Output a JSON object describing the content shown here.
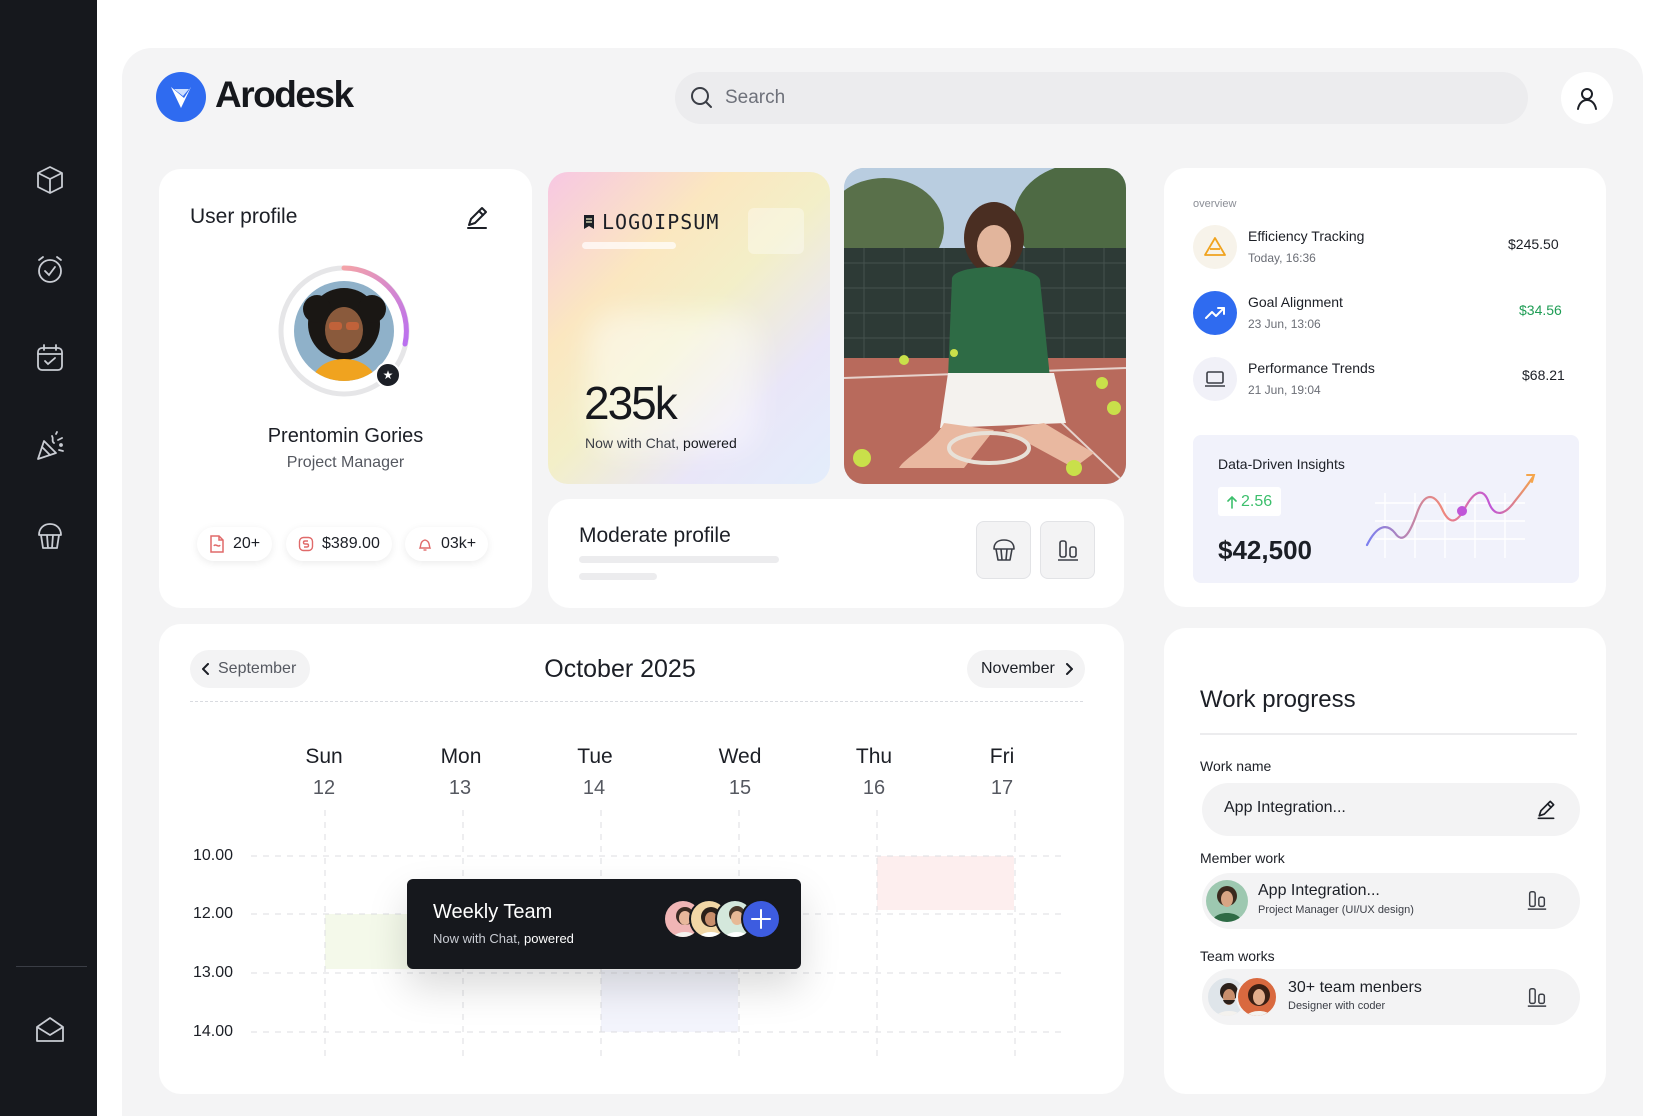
{
  "app": {
    "name": "Arodesk"
  },
  "search": {
    "placeholder": "Search"
  },
  "icons": {
    "sidebar": [
      "box-icon",
      "alarm-clock-icon",
      "calendar-check-icon",
      "party-popper-icon",
      "cupcake-icon",
      "mail-icon"
    ]
  },
  "user_profile": {
    "title": "User profile",
    "name": "Prentomin Gories",
    "role": "Project Manager",
    "stats": [
      {
        "icon": "file-icon",
        "value": "20+"
      },
      {
        "icon": "dollar-badge-icon",
        "value": "$389.00"
      },
      {
        "icon": "bell-icon",
        "value": "03k+"
      }
    ]
  },
  "promo": {
    "logo_text": "LOGOIPSUM",
    "metric": "235k",
    "caption_prefix": "Now with Chat,",
    "caption_bold": "powered"
  },
  "moderate_profile": {
    "title": "Moderate profile"
  },
  "overview": {
    "label": "overview",
    "items": [
      {
        "title": "Efficiency Tracking",
        "date": "Today, 16:36",
        "amount": "$245.50",
        "amount_color": "#1c1f26"
      },
      {
        "title": "Goal Alignment",
        "date": "23 Jun, 13:06",
        "amount": "$34.56",
        "amount_color": "#1f9d55"
      },
      {
        "title": "Performance Trends",
        "date": "21 Jun, 19:04",
        "amount": "$68.21",
        "amount_color": "#1c1f26"
      }
    ],
    "insights": {
      "title": "Data-Driven Insights",
      "delta": "2.56",
      "value": "$42,500"
    }
  },
  "calendar": {
    "prev": "September",
    "current": "October 2025",
    "next": "November",
    "days": [
      {
        "name": "Sun",
        "num": "12"
      },
      {
        "name": "Mon",
        "num": "13"
      },
      {
        "name": "Tue",
        "num": "14"
      },
      {
        "name": "Wed",
        "num": "15"
      },
      {
        "name": "Thu",
        "num": "16"
      },
      {
        "name": "Fri",
        "num": "17"
      }
    ],
    "times": [
      "10.00",
      "12.00",
      "13.00",
      "14.00"
    ],
    "event": {
      "title": "Weekly Team",
      "caption_prefix": "Now with Chat,",
      "caption_bold": "powered"
    }
  },
  "work_progress": {
    "title": "Work progress",
    "work_name_label": "Work name",
    "work_name_value": "App Integration...",
    "member_label": "Member work",
    "member": {
      "title": "App Integration...",
      "subtitle": "Project Manager (UI/UX design)"
    },
    "team_label": "Team works",
    "team": {
      "title": "30+ team menbers",
      "subtitle": "Designer with coder"
    }
  }
}
